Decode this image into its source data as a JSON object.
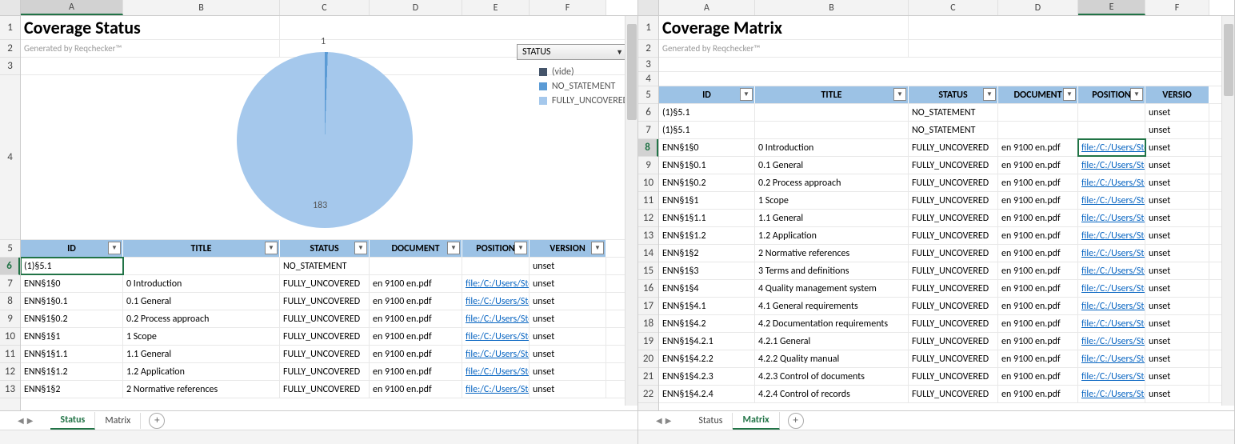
{
  "left": {
    "page_title": "Coverage Status",
    "subtitle": "Generated by Reqchecker™",
    "selected_col": "A",
    "selected_row": 6,
    "columns": [
      "A",
      "B",
      "C",
      "D",
      "E",
      "F"
    ],
    "row_numbers": [
      1,
      2,
      3,
      4,
      5,
      6,
      7,
      8,
      9,
      10,
      11,
      12,
      13
    ],
    "row_heights": {
      "1": 30,
      "2": 22,
      "3": 22,
      "4": 206,
      "default": 22
    },
    "table_headers": [
      "ID",
      "TITLE",
      "STATUS",
      "DOCUMENT",
      "POSITION",
      "VERSION"
    ],
    "rows": [
      {
        "id": "(1)§5.1",
        "title": "",
        "status": "NO_STATEMENT",
        "doc": "",
        "pos": "",
        "ver": "unset"
      },
      {
        "id": "ENN§1§0",
        "title": "0 Introduction",
        "status": "FULLY_UNCOVERED",
        "doc": "en 9100 en.pdf",
        "pos": "file:/C:/Users/Ste",
        "ver": "unset"
      },
      {
        "id": "ENN§1§0.1",
        "title": "0.1 General",
        "status": "FULLY_UNCOVERED",
        "doc": "en 9100 en.pdf",
        "pos": "file:/C:/Users/Ste",
        "ver": "unset"
      },
      {
        "id": "ENN§1§0.2",
        "title": "0.2 Process approach",
        "status": "FULLY_UNCOVERED",
        "doc": "en 9100 en.pdf",
        "pos": "file:/C:/Users/Ste",
        "ver": "unset"
      },
      {
        "id": "ENN§1§1",
        "title": "1 Scope",
        "status": "FULLY_UNCOVERED",
        "doc": "en 9100 en.pdf",
        "pos": "file:/C:/Users/Ste",
        "ver": "unset"
      },
      {
        "id": "ENN§1§1.1",
        "title": "1.1 General",
        "status": "FULLY_UNCOVERED",
        "doc": "en 9100 en.pdf",
        "pos": "file:/C:/Users/Ste",
        "ver": "unset"
      },
      {
        "id": "ENN§1§1.2",
        "title": "1.2 Application",
        "status": "FULLY_UNCOVERED",
        "doc": "en 9100 en.pdf",
        "pos": "file:/C:/Users/Ste",
        "ver": "unset"
      },
      {
        "id": "ENN§1§2",
        "title": "2 Normative references",
        "status": "FULLY_UNCOVERED",
        "doc": "en 9100 en.pdf",
        "pos": "file:/C:/Users/Ste",
        "ver": "unset"
      }
    ],
    "tabs": [
      "Status",
      "Matrix"
    ],
    "active_tab": "Status"
  },
  "right": {
    "page_title": "Coverage Matrix",
    "subtitle": "Generated by Reqchecker™",
    "selected_col": "E",
    "selected_row": 8,
    "columns": [
      "A",
      "B",
      "C",
      "D",
      "E",
      "F"
    ],
    "row_numbers": [
      1,
      2,
      3,
      4,
      5,
      6,
      7,
      8,
      9,
      10,
      11,
      12,
      13,
      14,
      15,
      16,
      17,
      18,
      19,
      20,
      21,
      22
    ],
    "row_heights": {
      "1": 30,
      "2": 22,
      "3": 18,
      "4": 18,
      "default": 22
    },
    "table_headers": [
      "ID",
      "TITLE",
      "STATUS",
      "DOCUMENT",
      "POSITION",
      "VERSION"
    ],
    "rows": [
      {
        "id": "(1)§5.1",
        "title": "",
        "status": "NO_STATEMENT",
        "doc": "",
        "pos": "",
        "ver": "unset"
      },
      {
        "id": "(1)§5.1",
        "title": "",
        "status": "NO_STATEMENT",
        "doc": "",
        "pos": "",
        "ver": "unset"
      },
      {
        "id": "ENN§1§0",
        "title": "0 Introduction",
        "status": "FULLY_UNCOVERED",
        "doc": "en 9100 en.pdf",
        "pos": "file:/C:/Users/Ste",
        "ver": "unset"
      },
      {
        "id": "ENN§1§0.1",
        "title": "0.1 General",
        "status": "FULLY_UNCOVERED",
        "doc": "en 9100 en.pdf",
        "pos": "file:/C:/Users/Ste",
        "ver": "unset"
      },
      {
        "id": "ENN§1§0.2",
        "title": "0.2 Process approach",
        "status": "FULLY_UNCOVERED",
        "doc": "en 9100 en.pdf",
        "pos": "file:/C:/Users/Ste",
        "ver": "unset"
      },
      {
        "id": "ENN§1§1",
        "title": "1 Scope",
        "status": "FULLY_UNCOVERED",
        "doc": "en 9100 en.pdf",
        "pos": "file:/C:/Users/Ste",
        "ver": "unset"
      },
      {
        "id": "ENN§1§1.1",
        "title": "1.1 General",
        "status": "FULLY_UNCOVERED",
        "doc": "en 9100 en.pdf",
        "pos": "file:/C:/Users/Ste",
        "ver": "unset"
      },
      {
        "id": "ENN§1§1.2",
        "title": "1.2 Application",
        "status": "FULLY_UNCOVERED",
        "doc": "en 9100 en.pdf",
        "pos": "file:/C:/Users/Ste",
        "ver": "unset"
      },
      {
        "id": "ENN§1§2",
        "title": "2 Normative references",
        "status": "FULLY_UNCOVERED",
        "doc": "en 9100 en.pdf",
        "pos": "file:/C:/Users/Ste",
        "ver": "unset"
      },
      {
        "id": "ENN§1§3",
        "title": "3 Terms and definitions",
        "status": "FULLY_UNCOVERED",
        "doc": "en 9100 en.pdf",
        "pos": "file:/C:/Users/Ste",
        "ver": "unset"
      },
      {
        "id": "ENN§1§4",
        "title": "4 Quality management system",
        "status": "FULLY_UNCOVERED",
        "doc": "en 9100 en.pdf",
        "pos": "file:/C:/Users/Ste",
        "ver": "unset"
      },
      {
        "id": "ENN§1§4.1",
        "title": "4.1 General requirements",
        "status": "FULLY_UNCOVERED",
        "doc": "en 9100 en.pdf",
        "pos": "file:/C:/Users/Ste",
        "ver": "unset"
      },
      {
        "id": "ENN§1§4.2",
        "title": "4.2 Documentation requirements",
        "status": "FULLY_UNCOVERED",
        "doc": "en 9100 en.pdf",
        "pos": "file:/C:/Users/Ste",
        "ver": "unset"
      },
      {
        "id": "ENN§1§4.2.1",
        "title": "4.2.1 General",
        "status": "FULLY_UNCOVERED",
        "doc": "en 9100 en.pdf",
        "pos": "file:/C:/Users/Ste",
        "ver": "unset"
      },
      {
        "id": "ENN§1§4.2.2",
        "title": "4.2.2 Quality manual",
        "status": "FULLY_UNCOVERED",
        "doc": "en 9100 en.pdf",
        "pos": "file:/C:/Users/Ste",
        "ver": "unset"
      },
      {
        "id": "ENN§1§4.2.3",
        "title": "4.2.3 Control of documents",
        "status": "FULLY_UNCOVERED",
        "doc": "en 9100 en.pdf",
        "pos": "file:/C:/Users/Ste",
        "ver": "unset"
      },
      {
        "id": "ENN§1§4.2.4",
        "title": "4.2.4 Control of records",
        "status": "FULLY_UNCOVERED",
        "doc": "en 9100 en.pdf",
        "pos": "file:/C:/Users/Ste",
        "ver": "unset"
      }
    ],
    "tabs": [
      "Status",
      "Matrix"
    ],
    "active_tab": "Matrix"
  },
  "chart_data": {
    "type": "pie",
    "title": "",
    "dropdown_label": "STATUS",
    "series": [
      {
        "name": "(vide)",
        "value": 0,
        "color": "#44546a"
      },
      {
        "name": "NO_STATEMENT",
        "value": 1,
        "color": "#5b9bd5"
      },
      {
        "name": "FULLY_UNCOVERED",
        "value": 183,
        "color": "#a5c8ec"
      }
    ],
    "data_labels": [
      "1",
      "183"
    ]
  },
  "col_widths_left": {
    "A": 128,
    "B": 196,
    "C": 112,
    "D": 116,
    "E": 84,
    "F": 96
  },
  "col_widths_right": {
    "A": 120,
    "B": 192,
    "C": 112,
    "D": 100,
    "E": 84,
    "F": 80
  }
}
